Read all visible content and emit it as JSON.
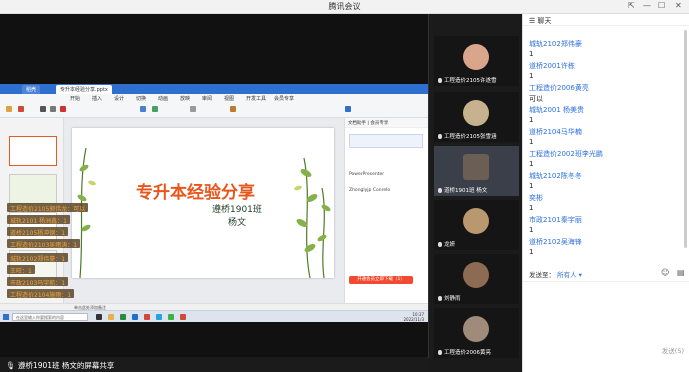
{
  "window": {
    "title": "腾讯会议"
  },
  "share_bar": {
    "label": "遵桥1901班 杨文的屏幕共享"
  },
  "wps": {
    "tabs": [
      "稻壳",
      "专升本经验分享.pptx"
    ],
    "menus": [
      "开始",
      "插入",
      "设计",
      "切换",
      "动画",
      "放映",
      "审阅",
      "视图",
      "开发工具",
      "会员专享"
    ],
    "slide": {
      "title": "专升本经验分享",
      "class": "遵桥1901班",
      "author": "杨文"
    },
    "side_panel": {
      "header": "文档助手  |  会员专享",
      "lines": [
        "PowerPresenter",
        "Zhonglyjp Conrelo"
      ],
      "button": "开通会员立即下载（1）"
    },
    "status": "单击此处添加备注",
    "search_placeholder": "在这里输入你要搜索的内容",
    "clock": {
      "time": "10:37",
      "date": "2022/11/3"
    }
  },
  "danmaku": [
    "工程造价2105郭伟龙：可以",
    "城轨2101 杨洲鑫：1",
    "道桥2105杨冲钢：1",
    "工程造价2103吴雨涛：1",
    "城轨2102郑伟豪：1",
    "王旺：1",
    "市政2103马宇航：1",
    "工程造价2104施雨：1"
  ],
  "participants": [
    {
      "name": "工程造价2105许遂雪",
      "avatar_color": "#d9a68c"
    },
    {
      "name": "工程造价2105张雪涵",
      "avatar_color": "#c7b28f"
    },
    {
      "name": "道桥1901班 杨文",
      "avatar_color": "#6a5e55"
    },
    {
      "name": "龙妍",
      "avatar_color": "#b9976f"
    },
    {
      "name": "刘静雨",
      "avatar_color": "#8d6a52"
    },
    {
      "name": "工程造价2006黄亮",
      "avatar_color": "#a08a7a"
    }
  ],
  "chat": {
    "header": "聊天",
    "messages": [
      {
        "type": "u",
        "text": "城轨2102郑伟豪"
      },
      {
        "type": "t",
        "text": "1"
      },
      {
        "type": "u",
        "text": "道桥2001许栋"
      },
      {
        "type": "t",
        "text": "1"
      },
      {
        "type": "u",
        "text": "工程造价2006黄亮"
      },
      {
        "type": "t",
        "text": "可以"
      },
      {
        "type": "u",
        "text": "城轨2001 杨美贵"
      },
      {
        "type": "t",
        "text": "1"
      },
      {
        "type": "u",
        "text": "道桥2104马华楠"
      },
      {
        "type": "t",
        "text": "1"
      },
      {
        "type": "u",
        "text": "工程造价2002班李光鹏"
      },
      {
        "type": "t",
        "text": "1"
      },
      {
        "type": "u",
        "text": "城轨2102陈冬冬"
      },
      {
        "type": "t",
        "text": "1"
      },
      {
        "type": "u",
        "text": "奕彬"
      },
      {
        "type": "t",
        "text": "1"
      },
      {
        "type": "u",
        "text": "市政2101秦宇丽"
      },
      {
        "type": "t",
        "text": "1"
      },
      {
        "type": "u",
        "text": "道桥2102吴海锋"
      },
      {
        "type": "t",
        "text": "1"
      }
    ],
    "send_to_label": "发送至：",
    "send_to_value": "所有人",
    "send_button": "发送(S)"
  }
}
